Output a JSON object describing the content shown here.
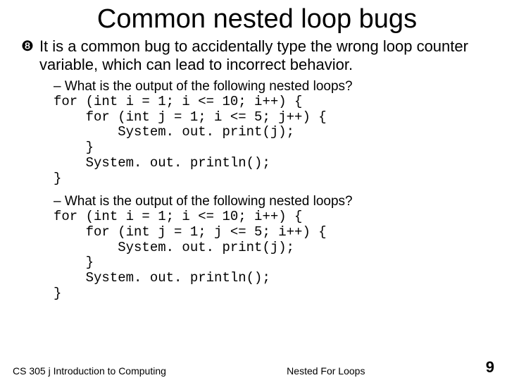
{
  "title": "Common nested loop bugs",
  "bullet": {
    "text": "It is a common bug to accidentally type the wrong loop counter variable, which can lead to incorrect behavior."
  },
  "sub1": {
    "question": "– What is the output of the following nested loops?",
    "code": "for (int i = 1; i <= 10; i++) {\n    for (int j = 1; i <= 5; j++) {\n        System. out. print(j);\n    }\n    System. out. println();\n}"
  },
  "sub2": {
    "question": "– What is the output of the following nested loops?",
    "code": "for (int i = 1; i <= 10; i++) {\n    for (int j = 1; j <= 5; i++) {\n        System. out. print(j);\n    }\n    System. out. println();\n}"
  },
  "footer": {
    "left": "CS 305 j Introduction to Computing",
    "center": "Nested For Loops",
    "page": "9"
  }
}
